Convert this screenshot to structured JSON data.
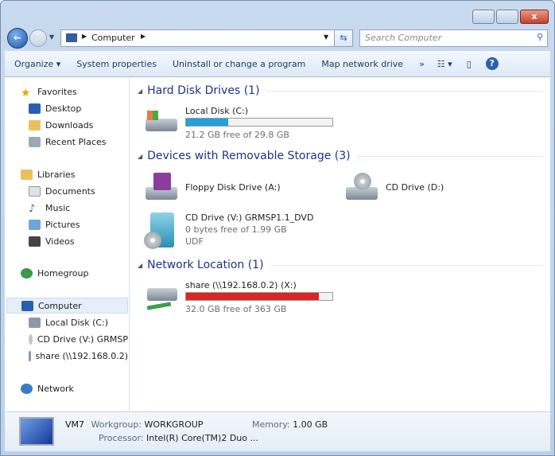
{
  "window": {
    "minimize": "–",
    "maximize": "□",
    "close": "x"
  },
  "address": {
    "crumb": "Computer",
    "search_placeholder": "Search Computer"
  },
  "toolbar": {
    "organize": "Organize ▾",
    "system_properties": "System properties",
    "uninstall": "Uninstall or change a program",
    "map_drive": "Map network drive",
    "more": "»"
  },
  "nav": {
    "favorites": "Favorites",
    "desktop": "Desktop",
    "downloads": "Downloads",
    "recent": "Recent Places",
    "libraries": "Libraries",
    "documents": "Documents",
    "music": "Music",
    "pictures": "Pictures",
    "videos": "Videos",
    "homegroup": "Homegroup",
    "computer": "Computer",
    "local_disk": "Local Disk (C:)",
    "cd_drive": "CD Drive (V:) GRMSP",
    "share": "share (\\\\192.168.0.2)",
    "network": "Network"
  },
  "groups": [
    {
      "title": "Hard Disk Drives (1)"
    },
    {
      "title": "Devices with Removable Storage (3)"
    },
    {
      "title": "Network Location (1)"
    }
  ],
  "drives": {
    "c": {
      "name": "Local Disk (C:)",
      "free": "21.2 GB free of 29.8 GB",
      "used_percent": 29,
      "color": "#26a0da"
    },
    "a": {
      "name": "Floppy Disk Drive (A:)"
    },
    "d": {
      "name": "CD Drive (D:)"
    },
    "v": {
      "name": "CD Drive (V:) GRMSP1.1_DVD",
      "free": "0 bytes free of 1.99 GB",
      "fs": "UDF"
    },
    "x": {
      "name": "share (\\\\192.168.0.2) (X:)",
      "free": "32.0 GB free of 363 GB",
      "used_percent": 91,
      "color": "#da2626"
    }
  },
  "details": {
    "name": "VM7",
    "workgroup_label": "Workgroup:",
    "workgroup": "WORKGROUP",
    "memory_label": "Memory:",
    "memory": "1.00 GB",
    "processor_label": "Processor:",
    "processor": "Intel(R) Core(TM)2 Duo ..."
  }
}
